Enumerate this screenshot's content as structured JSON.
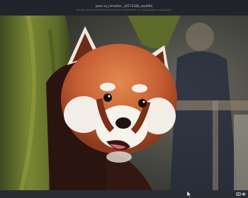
{
  "window": {
    "title": "pexe xa_linitaifee _2017118E_azadfd4",
    "hint": "Drücken Sie die Esstaste/Taste oder Alt und Schaltfläche, um die Navigation auszuwählen"
  },
  "viewer": {
    "image_subject": "Red panda peeking from behind a mossy tree trunk"
  },
  "status_icons": [
    "cursor-pointer-icon",
    "keyboard-icon",
    "volume-icon"
  ],
  "colors": {
    "title_bar": "#23242b",
    "status_bar": "#2b2c33",
    "fur_orange": "#c8643a",
    "fur_dark": "#3a1e15",
    "moss": "#6e7a2e"
  }
}
